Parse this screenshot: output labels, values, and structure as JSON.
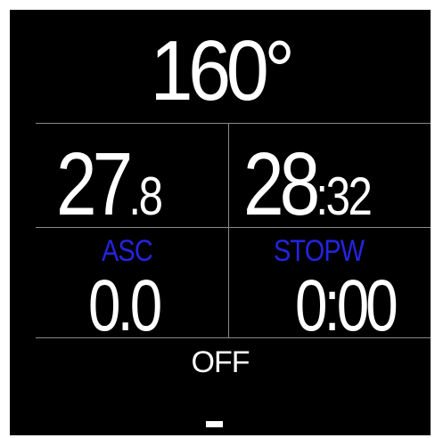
{
  "heading": {
    "value": "160°"
  },
  "row1": {
    "left": {
      "main": "27",
      "sub": ".8"
    },
    "right": {
      "main": "28",
      "sub": ":32"
    }
  },
  "row2": {
    "left": {
      "label": "ASC",
      "value": "0.0"
    },
    "right": {
      "label": "STOPW",
      "value": "0:00"
    }
  },
  "status": {
    "mode": "OFF",
    "placeholder": "--"
  },
  "colors": {
    "background": "#000000",
    "text": "#ffffff",
    "label": "#2424e0",
    "divider": "#8a8a8a"
  }
}
